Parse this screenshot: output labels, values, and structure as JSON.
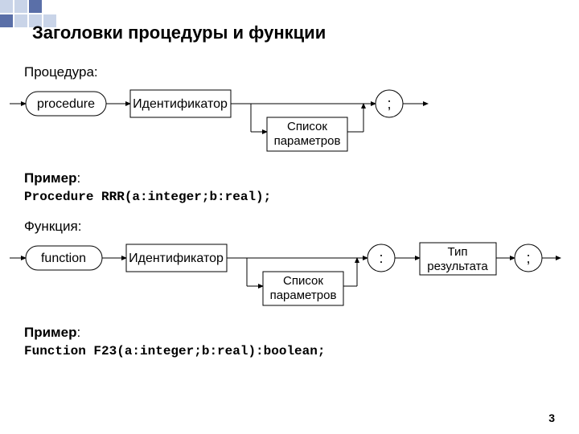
{
  "title": "Заголовки процедуры и функции",
  "pageNumber": "3",
  "procedure": {
    "label": "Процедура:",
    "nodes": {
      "keyword": "procedure",
      "identifier": "Идентификатор",
      "params_l1": "Список",
      "params_l2": "параметров",
      "semicolon": ";"
    },
    "exampleLabel": "Пример",
    "exampleColon": ":",
    "exampleCode": "Procedure RRR(a:integer;b:real);"
  },
  "function": {
    "label": "Функция:",
    "nodes": {
      "keyword": "function",
      "identifier": "Идентификатор",
      "params_l1": "Список",
      "params_l2": "параметров",
      "colon": ":",
      "result_l1": "Тип",
      "result_l2": "результата",
      "semicolon": ";"
    },
    "exampleLabel": "Пример",
    "exampleColon": ":",
    "exampleCode": "Function F23(a:integer;b:real):boolean;"
  }
}
